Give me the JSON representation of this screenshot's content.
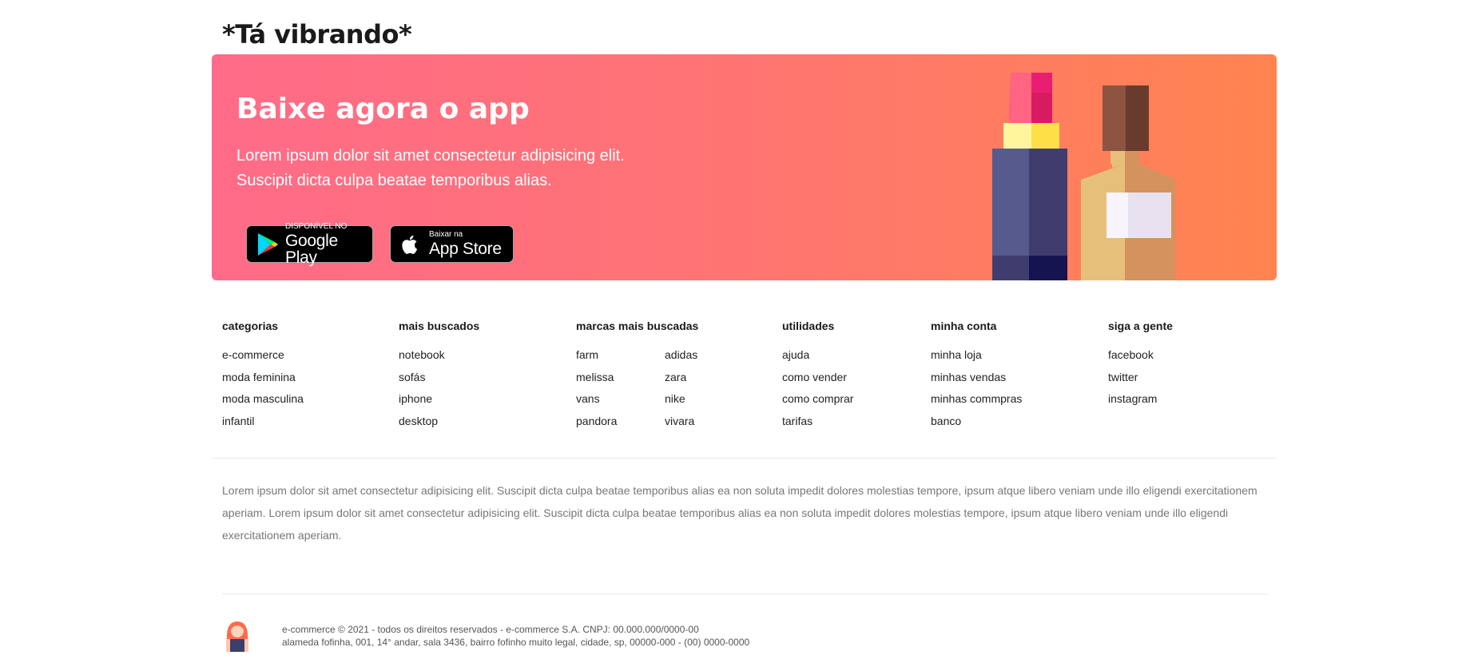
{
  "section_title": "*Tá vibrando*",
  "banner": {
    "title": "Baixe agora o app",
    "text_line1": "Lorem ipsum dolor sit amet consectetur adipisicing elit.",
    "text_line2": "Suscipit dicta culpa beatae temporibus alias.",
    "google_play": {
      "small": "DISPONÍVEL NO",
      "big": "Google Play",
      "icon": "google-play-icon"
    },
    "app_store": {
      "small": "Baixar na",
      "big": "App Store",
      "icon": "apple-icon"
    }
  },
  "footer": {
    "categorias": {
      "title": "categorias",
      "items": [
        "e-commerce",
        "moda feminina",
        "moda masculina",
        "infantil"
      ]
    },
    "mais_buscados": {
      "title": "mais buscados",
      "items": [
        "notebook",
        "sofás",
        "iphone",
        "desktop"
      ]
    },
    "marcas": {
      "title": "marcas mais buscadas",
      "col1": [
        "farm",
        "melissa",
        "vans",
        "pandora"
      ],
      "col2": [
        "adidas",
        "zara",
        "nike",
        "vivara"
      ]
    },
    "utilidades": {
      "title": "utilidades",
      "items": [
        "ajuda",
        "como vender",
        "como comprar",
        "tarifas"
      ]
    },
    "minha_conta": {
      "title": "minha conta",
      "items": [
        "minha loja",
        "minhas vendas",
        "minhas commpras",
        "banco"
      ]
    },
    "siga": {
      "title": "siga a gente",
      "items": [
        "facebook",
        "twitter",
        "instagram"
      ]
    }
  },
  "description": "Lorem ipsum dolor sit amet consectetur adipisicing elit. Suscipit dicta culpa beatae temporibus alias ea non soluta impedit dolores molestias tempore, ipsum atque libero veniam unde illo eligendi exercitationem aperiam. Lorem ipsum dolor sit amet consectetur adipisicing elit. Suscipit dicta culpa beatae temporibus alias ea non soluta impedit dolores molestias tempore, ipsum atque libero veniam unde illo eligendi exercitationem aperiam.",
  "copyright": {
    "line1": "e-commerce © 2021 - todos os direitos reservados - e-commerce S.A. CNPJ: 00.000.000/0000-00",
    "line2": "alameda fofinha, 001, 14° andar, sala 3436, bairro fofinho muito legal, cidade, sp, 00000-000 - (00) 0000-0000"
  },
  "colors": {
    "banner_start": "#ff6b88",
    "banner_end": "#ff8450"
  }
}
